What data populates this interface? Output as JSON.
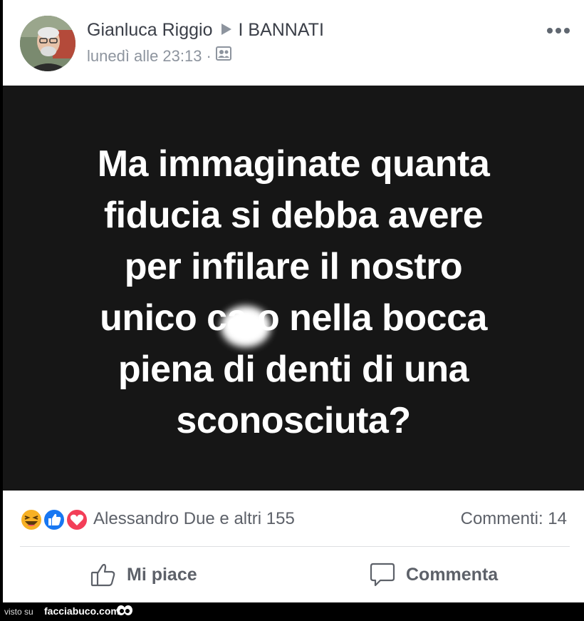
{
  "post": {
    "author": "Gianluca Riggio",
    "group": "I BANNATI",
    "timestamp": "lunedì alle 23:13",
    "separator": "·",
    "content_lines": [
      "Ma  immaginate quanta",
      "fiducia si debba avere",
      "per infilare il nostro",
      "unico ca  o nella bocca",
      "piena di denti di una",
      "sconosciuta?"
    ]
  },
  "reactions": {
    "names": "Alessandro Due e altri 155",
    "comments": "Commenti: 14"
  },
  "actions": {
    "like": "Mi piace",
    "comment": "Commenta"
  },
  "footer": {
    "prefix": "visto su",
    "brand": "facciabuco.com"
  },
  "colors": {
    "post_background": "#161616",
    "accent_like": "#1877f2",
    "accent_love": "#f33e58",
    "accent_haha": "#f7b125"
  }
}
